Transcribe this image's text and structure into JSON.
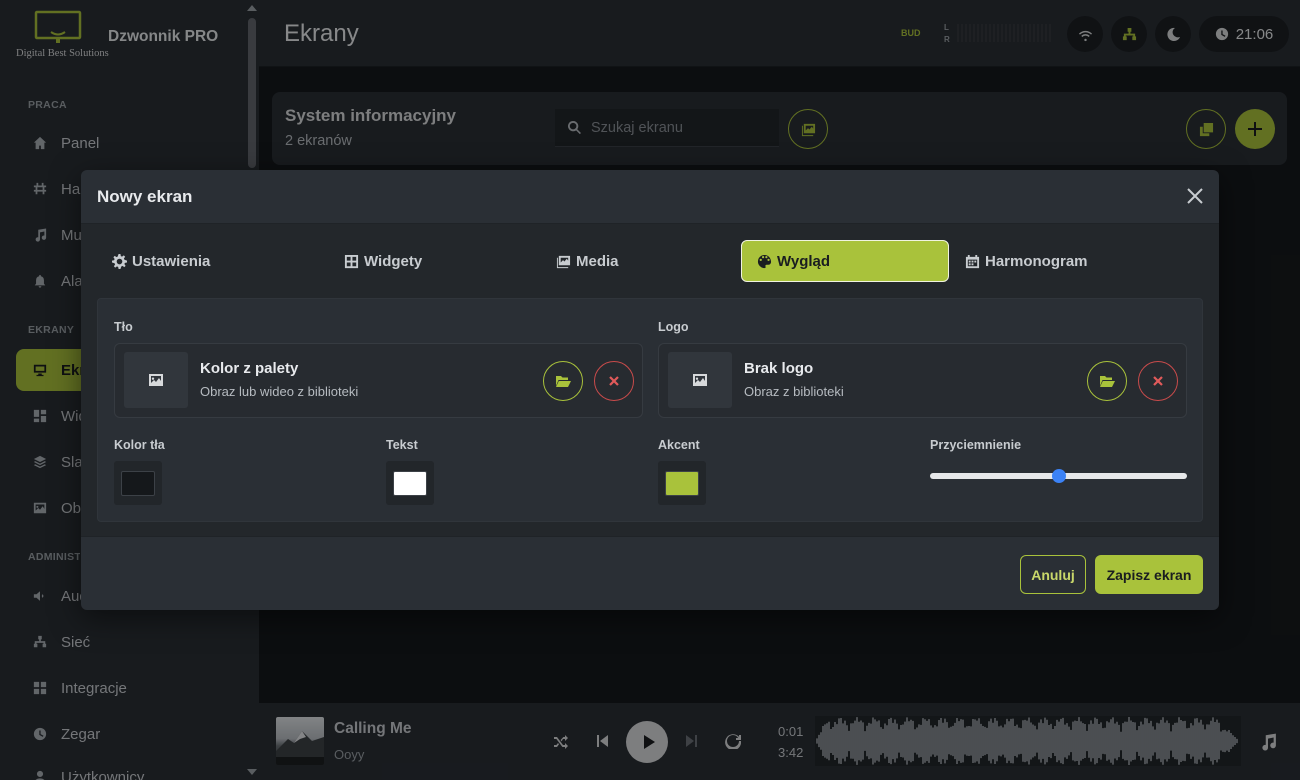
{
  "sidebar": {
    "app_name": "Dzwonnik PRO",
    "logo_text": "Digital Best Solutions",
    "sections": [
      {
        "label": "PRACA"
      },
      {
        "label": "EKRANY"
      },
      {
        "label": "ADMINISTRACJA"
      }
    ],
    "items": [
      {
        "label": "Panel",
        "icon": "home-icon"
      },
      {
        "label": "Harmonogram",
        "icon": "calendar-icon"
      },
      {
        "label": "Muzyka",
        "icon": "music-icon"
      },
      {
        "label": "Alarmy",
        "icon": "bell-icon"
      },
      {
        "label": "Ekrany",
        "icon": "monitor-icon",
        "active": true
      },
      {
        "label": "Widgety",
        "icon": "widgets-icon"
      },
      {
        "label": "Slajdy",
        "icon": "layers-icon"
      },
      {
        "label": "Obrazy",
        "icon": "image-icon"
      },
      {
        "label": "Audio",
        "icon": "speaker-icon"
      },
      {
        "label": "Sieć",
        "icon": "network-icon"
      },
      {
        "label": "Integracje",
        "icon": "integrations-icon"
      },
      {
        "label": "Zegar",
        "icon": "clock-icon"
      },
      {
        "label": "Użytkownicy",
        "icon": "user-icon"
      }
    ]
  },
  "header": {
    "title": "Ekrany",
    "bud_label": "BUD",
    "lr_top": "L",
    "lr_bottom": "R",
    "time": "21:06"
  },
  "toolbar": {
    "title": "System informacyjny",
    "count": "2 ekranów",
    "search_placeholder": "Szukaj ekranu"
  },
  "modal": {
    "title": "Nowy ekran",
    "tabs": [
      {
        "label": "Ustawienia",
        "icon": "gear-icon"
      },
      {
        "label": "Widgety",
        "icon": "grid-icon"
      },
      {
        "label": "Media",
        "icon": "images-icon"
      },
      {
        "label": "Wygląd",
        "icon": "palette-icon",
        "active": true
      },
      {
        "label": "Harmonogram",
        "icon": "calendar-icon"
      }
    ],
    "background": {
      "label": "Tło",
      "title": "Kolor z palety",
      "subtitle": "Obraz lub wideo z biblioteki"
    },
    "logo": {
      "label": "Logo",
      "title": "Brak logo",
      "subtitle": "Obraz z biblioteki"
    },
    "colors": {
      "bg_label": "Kolor tła",
      "bg_value": "#15181b",
      "text_label": "Tekst",
      "text_value": "#ffffff",
      "accent_label": "Akcent",
      "accent_value": "#a9c23b"
    },
    "dimming": {
      "label": "Przyciemnienie",
      "value": 0.5
    },
    "cancel_label": "Anuluj",
    "save_label": "Zapisz ekran"
  },
  "player": {
    "title": "Calling Me",
    "artist": "Ooyy",
    "current_time": "0:01",
    "duration": "3:42"
  },
  "colors": {
    "accent": "#a9c23b",
    "danger": "#e05a5a",
    "slider": "#3b82f6"
  }
}
